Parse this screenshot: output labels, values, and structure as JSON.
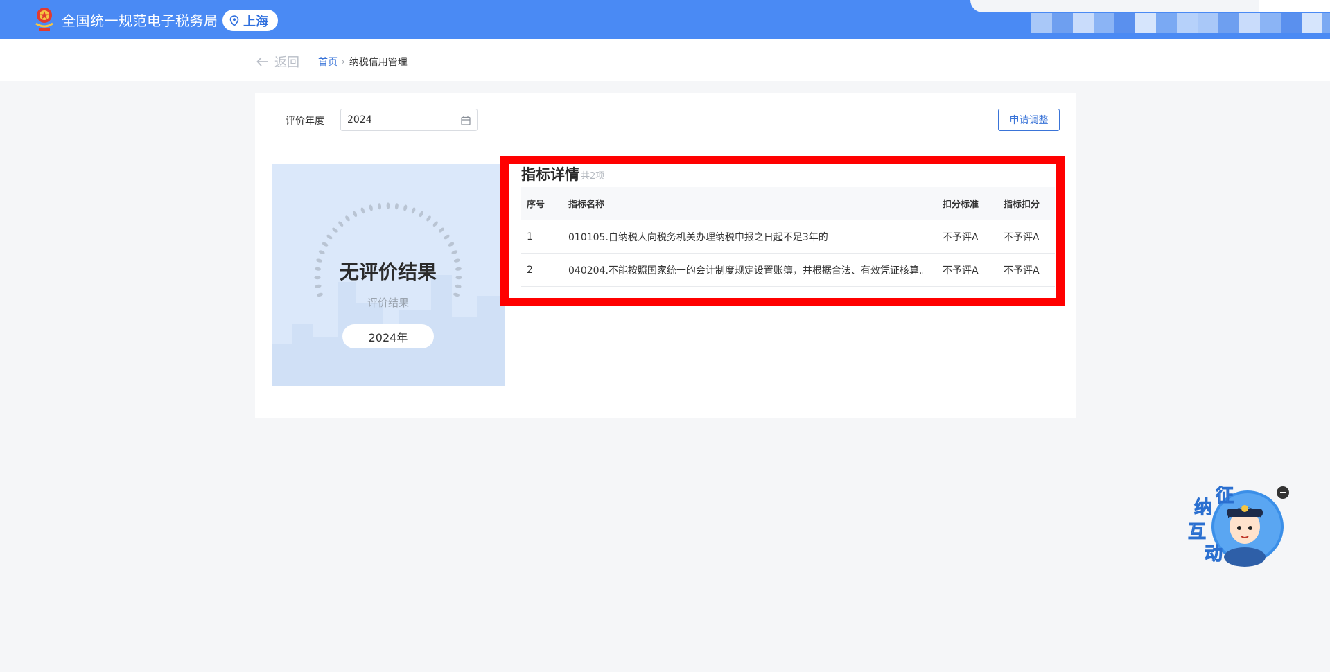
{
  "header": {
    "app_title": "全国统一规范电子税务局",
    "region": "上海"
  },
  "nav": {
    "back_label": "返回",
    "breadcrumb": {
      "home": "首页",
      "current": "纳税信用管理"
    }
  },
  "filters": {
    "year_label": "评价年度",
    "year_value": "2024"
  },
  "actions": {
    "adjust_label": "申请调整"
  },
  "result": {
    "title": "无评价结果",
    "subtitle": "评价结果",
    "year": "2024年"
  },
  "details": {
    "title": "指标详情",
    "count": "共2项",
    "columns": [
      "序号",
      "指标名称",
      "扣分标准",
      "指标扣分"
    ],
    "rows": [
      [
        "1",
        "010105.自纳税人向税务机关办理纳税申报之日起不足3年的",
        "不予评A",
        "不予评A"
      ],
      [
        "2",
        "040204.不能按照国家统一的会计制度规定设置账簿，并根据合法、有效凭证核算...",
        "不予评A",
        "不予评A"
      ]
    ]
  },
  "mascot": {
    "chars": [
      "征",
      "纳",
      "互",
      "动"
    ]
  },
  "colors": {
    "header_blue": "#4a8af4",
    "accent": "#3a74d8",
    "highlight": "#ff0000",
    "result_bg": "#dbe8fa"
  },
  "icons": {
    "logo": "tax-emblem-icon",
    "region": "location-pin-icon",
    "back": "arrow-left-icon",
    "calendar": "calendar-icon",
    "close": "minus-circle-icon"
  }
}
